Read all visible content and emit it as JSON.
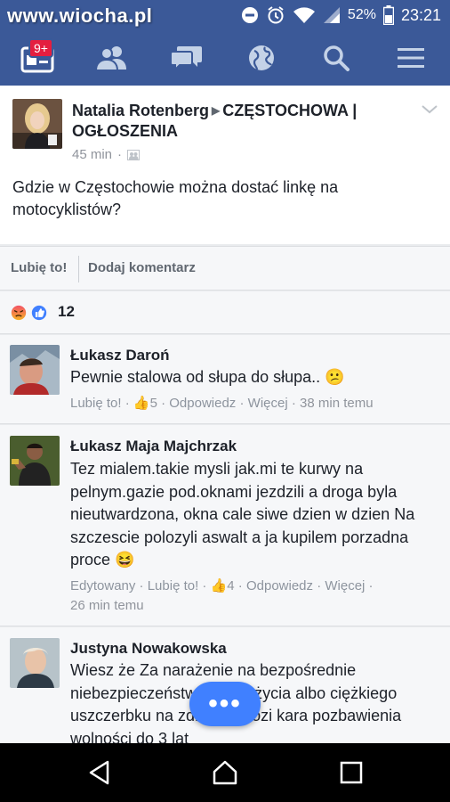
{
  "status_bar": {
    "watermark": "www.wiocha.pl",
    "battery": "52%",
    "time": "23:21"
  },
  "nav": {
    "badge": "9+",
    "items": [
      "news-feed",
      "friends",
      "messages",
      "notifications",
      "search",
      "menu"
    ]
  },
  "post": {
    "author": "Natalia Rotenberg",
    "group": "CZĘSTOCHOWA | OGŁOSZENIA",
    "time": "45 min",
    "text": "Gdzie w Częstochowie można dostać linkę na motocyklistów?"
  },
  "actions": {
    "like": "Lubię to!",
    "comment": "Dodaj komentarz"
  },
  "reactions": {
    "count": "12",
    "types": [
      "angry",
      "like"
    ]
  },
  "comments": [
    {
      "name": "Łukasz Daroń",
      "text": "Pewnie stalowa od słupa do słupa..",
      "emoji": "😕",
      "edited": "",
      "like": "Lubię to!",
      "likes": "5",
      "reply": "Odpowiedz",
      "more": "Więcej",
      "time": "38 min temu"
    },
    {
      "name": "Łukasz Maja Majchrzak",
      "text": "Tez mialem.takie mysli jak.mi te kurwy na pelnym.gazie pod.oknami jezdzili a droga byla nieutwardzona, okna cale siwe dzien w dzien Na szczescie polozyli aswalt a ja kupilem porzadna proce",
      "emoji": "😆",
      "edited": "Edytowany",
      "like": "Lubię to!",
      "likes": "4",
      "reply": "Odpowiedz",
      "more": "Więcej",
      "time": "26 min temu"
    },
    {
      "name": "Justyna Nowakowska",
      "text": "Wiesz że Za narażenie na bezpośrednie niebezpieczeństwo utraty życia albo ciężkiego uszczerbku na zdrowiu grozi kara pozbawienia wolności do 3 lat"
    }
  ],
  "fab": "•••",
  "colors": {
    "brand": "#3b5998",
    "fab": "#4080ff",
    "badge": "#e41e3f"
  }
}
